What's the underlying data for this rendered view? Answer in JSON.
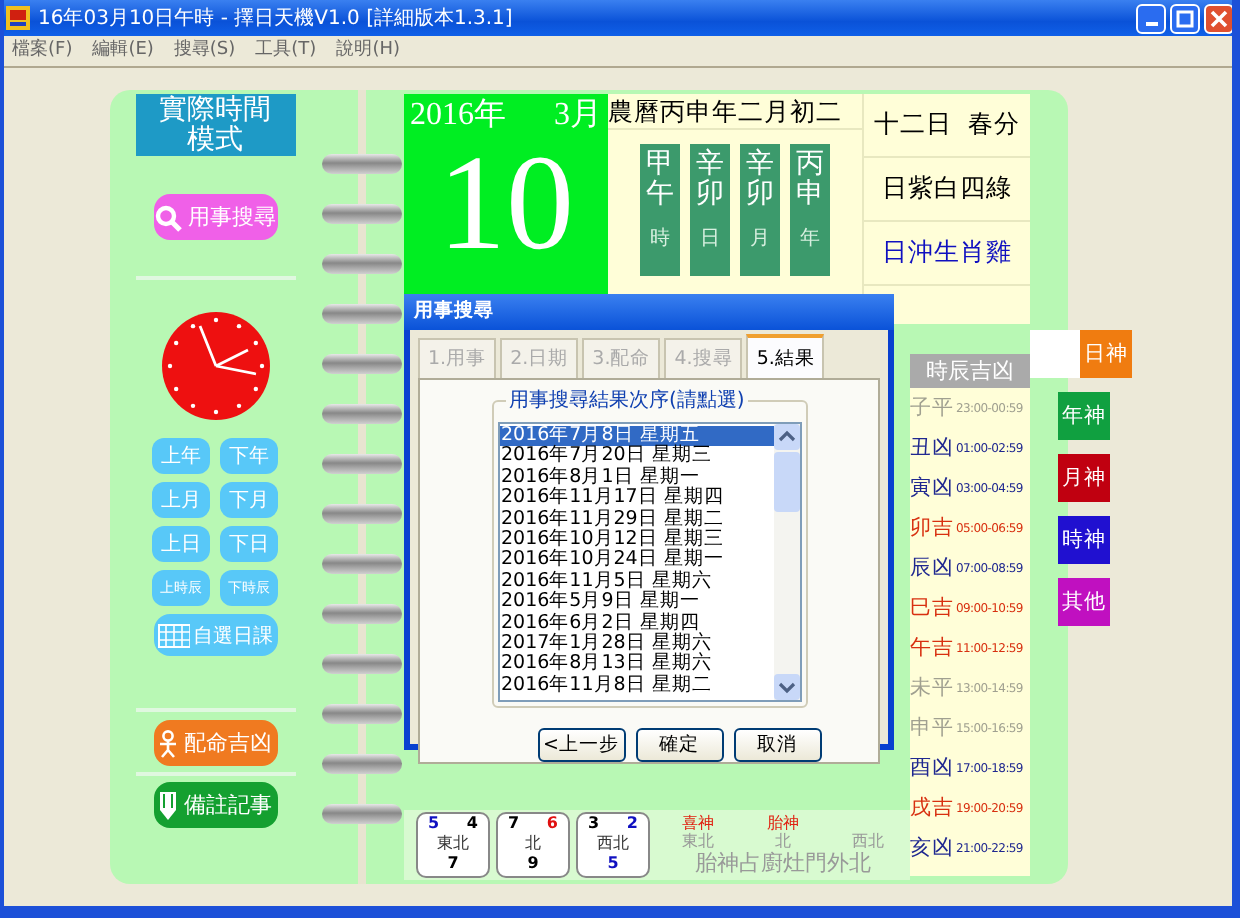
{
  "window": {
    "title": "16年03月10日午時 - 擇日天機V1.0 [詳細版本1.3.1]"
  },
  "menu": [
    "檔案(F)",
    "編輯(E)",
    "搜尋(S)",
    "工具(T)",
    "說明(H)"
  ],
  "left_panel": {
    "mode_title": "實際時間模式",
    "search_button": "用事搜尋",
    "nav_buttons": [
      "上年",
      "下年",
      "上月",
      "下月",
      "上日",
      "下日",
      "上時辰",
      "下時辰"
    ],
    "custom_button": "自選日課",
    "match_button": "配命吉凶",
    "notes_button": "備註記事"
  },
  "date": {
    "year": "2016年",
    "month": "3月",
    "day": "10"
  },
  "lunar": {
    "title": "農曆丙申年二月初二",
    "pillars": [
      {
        "stem_branch": "甲午",
        "label": "時"
      },
      {
        "stem_branch": "辛卯",
        "label": "日"
      },
      {
        "stem_branch": "辛卯",
        "label": "月"
      },
      {
        "stem_branch": "丙申",
        "label": "年"
      }
    ]
  },
  "info": [
    {
      "text": "十二日  春分",
      "kind": "plain"
    },
    {
      "text": "日紫白四綠",
      "kind": "plain"
    },
    {
      "text": "日沖生肖雞",
      "kind": "clash"
    }
  ],
  "hours": {
    "title": "時辰吉凶",
    "rows": [
      {
        "name": "子平",
        "time": "23:00-00:59",
        "kind": "neutral"
      },
      {
        "name": "丑凶",
        "time": "01:00-02:59",
        "kind": "bad"
      },
      {
        "name": "寅凶",
        "time": "03:00-04:59",
        "kind": "bad"
      },
      {
        "name": "卯吉",
        "time": "05:00-06:59",
        "kind": "good"
      },
      {
        "name": "辰凶",
        "time": "07:00-08:59",
        "kind": "bad"
      },
      {
        "name": "巳吉",
        "time": "09:00-10:59",
        "kind": "good"
      },
      {
        "name": "午吉",
        "time": "11:00-12:59",
        "kind": "good"
      },
      {
        "name": "未平",
        "time": "13:00-14:59",
        "kind": "neutral"
      },
      {
        "name": "申平",
        "time": "15:00-16:59",
        "kind": "neutral"
      },
      {
        "name": "酉凶",
        "time": "17:00-18:59",
        "kind": "bad"
      },
      {
        "name": "戌吉",
        "time": "19:00-20:59",
        "kind": "good"
      },
      {
        "name": "亥凶",
        "time": "21:00-22:59",
        "kind": "bad"
      }
    ]
  },
  "side_tabs": [
    {
      "label": "日神",
      "color": "#f07c10",
      "selected": true
    },
    {
      "label": "年神",
      "color": "#10a040",
      "selected": false
    },
    {
      "label": "月神",
      "color": "#c00010",
      "selected": false
    },
    {
      "label": "時神",
      "color": "#2010d0",
      "selected": false
    },
    {
      "label": "其他",
      "color": "#c010c0",
      "selected": false
    }
  ],
  "compass": [
    {
      "top_left": {
        "text": "5",
        "color": "#1010c0"
      },
      "top_right": {
        "text": "4",
        "color": "#000000"
      },
      "direction": "東北",
      "bottom": {
        "text": "7",
        "color": "#000000"
      }
    },
    {
      "top_left": {
        "text": "7",
        "color": "#000000"
      },
      "top_right": {
        "text": "6",
        "color": "#e01010"
      },
      "direction": "北",
      "bottom": {
        "text": "9",
        "color": "#000000"
      }
    },
    {
      "top_left": {
        "text": "3",
        "color": "#000000"
      },
      "top_right": {
        "text": "2",
        "color": "#1010c0"
      },
      "direction": "西北",
      "bottom": {
        "text": "5",
        "color": "#1010c0"
      }
    }
  ],
  "gods": [
    {
      "label": "喜神",
      "direction": "東北"
    },
    {
      "label": "胎神",
      "direction": "北"
    },
    {
      "direction": "西北"
    }
  ],
  "fetus_note": "胎神占廚灶門外北",
  "dialog": {
    "title": "用事搜尋",
    "tabs": [
      {
        "label": "1.用事",
        "selected": false,
        "disabled": true
      },
      {
        "label": "2.日期",
        "selected": false,
        "disabled": true
      },
      {
        "label": "3.配命",
        "selected": false,
        "disabled": true
      },
      {
        "label": "4.搜尋",
        "selected": false,
        "disabled": true
      },
      {
        "label": "5.結果",
        "selected": true,
        "disabled": false
      }
    ],
    "group_title": "用事搜尋結果次序(請點選)",
    "results": [
      {
        "text": "2016年7月8日 星期五",
        "selected": true
      },
      {
        "text": "2016年7月20日 星期三",
        "selected": false
      },
      {
        "text": "2016年8月1日 星期一",
        "selected": false
      },
      {
        "text": "2016年11月17日 星期四",
        "selected": false
      },
      {
        "text": "2016年11月29日 星期二",
        "selected": false
      },
      {
        "text": "2016年10月12日 星期三",
        "selected": false
      },
      {
        "text": "2016年10月24日 星期一",
        "selected": false
      },
      {
        "text": "2016年11月5日 星期六",
        "selected": false
      },
      {
        "text": "2016年5月9日 星期一",
        "selected": false
      },
      {
        "text": "2016年6月2日 星期四",
        "selected": false
      },
      {
        "text": "2017年1月28日 星期六",
        "selected": false
      },
      {
        "text": "2016年8月13日 星期六",
        "selected": false
      },
      {
        "text": "2016年11月8日 星期二",
        "selected": false
      }
    ],
    "buttons": [
      "<上一步",
      "確定",
      "取消"
    ]
  }
}
